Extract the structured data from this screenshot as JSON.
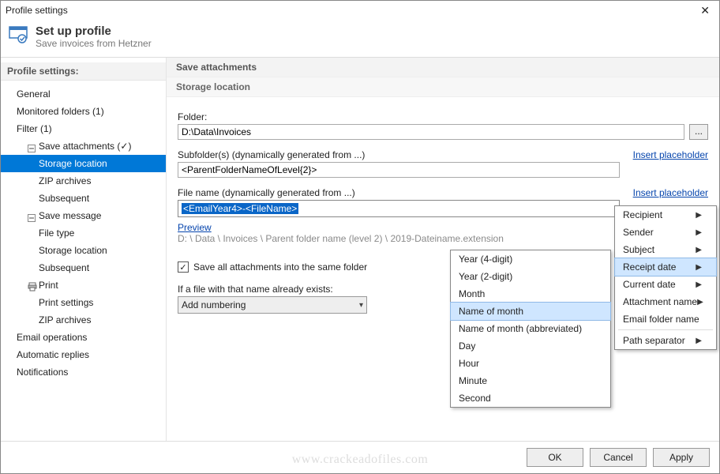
{
  "titlebar": {
    "title": "Profile settings"
  },
  "header": {
    "title": "Set up profile",
    "subtitle": "Save invoices from Hetzner"
  },
  "sidebar": {
    "heading": "Profile settings:",
    "items": [
      {
        "label": "General"
      },
      {
        "label": "Monitored folders (1)"
      },
      {
        "label": "Filter (1)"
      },
      {
        "label": "Save attachments (✓)"
      },
      {
        "label": "Storage location"
      },
      {
        "label": "ZIP archives"
      },
      {
        "label": "Subsequent"
      },
      {
        "label": "Save message"
      },
      {
        "label": "File type"
      },
      {
        "label": "Storage location"
      },
      {
        "label": "Subsequent"
      },
      {
        "label": "Print"
      },
      {
        "label": "Print settings"
      },
      {
        "label": "ZIP archives"
      },
      {
        "label": "Email operations"
      },
      {
        "label": "Automatic replies"
      },
      {
        "label": "Notifications"
      }
    ]
  },
  "main": {
    "section": "Save attachments",
    "subsection": "Storage location",
    "folder_label": "Folder:",
    "folder_value": "D:\\Data\\Invoices",
    "subfolder_label": "Subfolder(s) (dynamically generated from ...)",
    "subfolder_value": "<ParentFolderNameOfLevel{2}>",
    "insert_placeholder": "Insert placeholder",
    "filename_label": "File name (dynamically generated from ...)",
    "filename_value": "<EmailYear4>-<FileName>",
    "preview_link": "Preview",
    "preview_path": "D: \\ Data \\ Invoices \\ Parent folder name (level 2) \\ 2019-Dateiname.extension",
    "save_all_label": "Save all attachments into the same folder",
    "exists_label": "If a file with that name already exists:",
    "exists_value": "Add numbering"
  },
  "menu1": {
    "items": [
      {
        "label": "Recipient",
        "arrow": true
      },
      {
        "label": "Sender",
        "arrow": true
      },
      {
        "label": "Subject",
        "arrow": true
      },
      {
        "label": "Receipt date",
        "arrow": true,
        "selected": true
      },
      {
        "label": "Current date",
        "arrow": true
      },
      {
        "label": "Attachment name",
        "arrow": true
      },
      {
        "label": "Email folder name",
        "arrow": false
      },
      {
        "label": "Path separator",
        "arrow": true,
        "sepBefore": true
      }
    ]
  },
  "menu2": {
    "items": [
      {
        "label": "Year (4-digit)"
      },
      {
        "label": "Year (2-digit)"
      },
      {
        "label": "Month"
      },
      {
        "label": "Name of month",
        "selected": true
      },
      {
        "label": "Name of month (abbreviated)"
      },
      {
        "label": "Day"
      },
      {
        "label": "Hour"
      },
      {
        "label": "Minute"
      },
      {
        "label": "Second"
      }
    ]
  },
  "buttons": {
    "ok": "OK",
    "cancel": "Cancel",
    "apply": "Apply"
  },
  "watermark": "www.crackeadofiles.com"
}
